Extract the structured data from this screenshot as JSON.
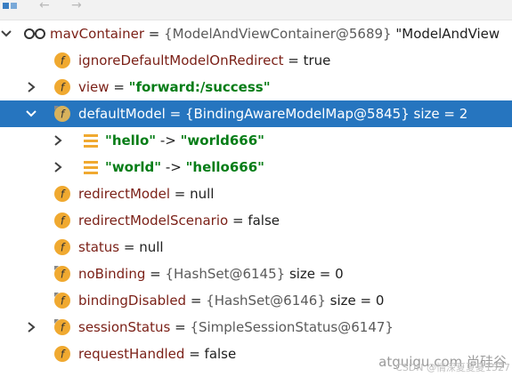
{
  "rows": [
    {
      "name": "mavContainer",
      "sep": " = ",
      "value": "{ModelAndViewContainer@5689} ",
      "extra": "\"ModelAndView"
    },
    {
      "name": "ignoreDefaultModelOnRedirect",
      "sep": " = ",
      "value": "true"
    },
    {
      "name": "view",
      "sep": " = ",
      "value": "\"forward:/success\""
    },
    {
      "name": "defaultModel",
      "sep": " = ",
      "value": "{BindingAwareModelMap@5845}",
      "extra": "  size = 2"
    },
    {
      "name": "\"hello\"",
      "sep": " -> ",
      "value": "\"world666\""
    },
    {
      "name": "\"world\"",
      "sep": " -> ",
      "value": "\"hello666\""
    },
    {
      "name": "redirectModel",
      "sep": " = ",
      "value": "null"
    },
    {
      "name": "redirectModelScenario",
      "sep": " = ",
      "value": "false"
    },
    {
      "name": "status",
      "sep": " = ",
      "value": "null"
    },
    {
      "name": "noBinding",
      "sep": " = ",
      "value": "{HashSet@6145}",
      "extra": "  size = 0"
    },
    {
      "name": "bindingDisabled",
      "sep": " = ",
      "value": "{HashSet@6146}",
      "extra": "  size = 0"
    },
    {
      "name": "sessionStatus",
      "sep": " = ",
      "value": "{SimpleSessionStatus@6147}"
    },
    {
      "name": "requestHandled",
      "sep": " = ",
      "value": "false"
    }
  ],
  "watermark": {
    "line1": "atguigu.com 尚硅谷",
    "line2": "CSDN @情深夏夏夏1527"
  },
  "icons": {
    "field": "f",
    "watch": "glasses-icon",
    "map_entry": "map-entry-icon"
  },
  "colors": {
    "selection": "#2675bf",
    "field_icon": "#f0a930",
    "string": "#067d17",
    "key": "#7a1f16"
  }
}
